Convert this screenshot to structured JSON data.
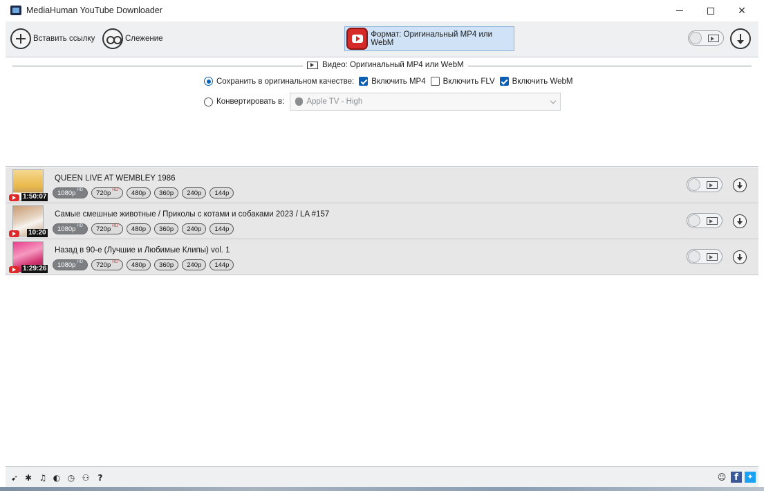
{
  "window": {
    "title": "MediaHuman YouTube Downloader"
  },
  "toolbar": {
    "paste_label": "Вставить ссылку",
    "track_label": "Слежение",
    "format_label": "Формат: Оригинальный MP4 или WebM"
  },
  "settings": {
    "section_title": "Видео: Оригинальный MP4 или WebM",
    "keep_original_label": "Сохранить в оригинальном качестве:",
    "include_mp4_label": "Включить MP4",
    "include_flv_label": "Включить FLV",
    "include_webm_label": "Включить WebM",
    "convert_label": "Конвертировать в:",
    "convert_target": "Apple TV - High",
    "keep_original_selected": true,
    "include_mp4": true,
    "include_flv": false,
    "include_webm": true
  },
  "items": [
    {
      "title": "QUEEN LIVE AT WEMBLEY 1986",
      "duration": "1:50:07",
      "qualities": [
        {
          "label": "1080p",
          "tag": "HD",
          "selected": true
        },
        {
          "label": "720p",
          "tag": "HD",
          "selected": false
        },
        {
          "label": "480p",
          "tag": "",
          "selected": false
        },
        {
          "label": "360p",
          "tag": "",
          "selected": false
        },
        {
          "label": "240p",
          "tag": "",
          "selected": false
        },
        {
          "label": "144p",
          "tag": "",
          "selected": false
        }
      ]
    },
    {
      "title": "Самые смешные животные / Приколы с котами и собаками 2023 / LA #157",
      "duration": "10:20",
      "qualities": [
        {
          "label": "1080p",
          "tag": "HD",
          "selected": true
        },
        {
          "label": "720p",
          "tag": "HD",
          "selected": false
        },
        {
          "label": "480p",
          "tag": "",
          "selected": false
        },
        {
          "label": "360p",
          "tag": "",
          "selected": false
        },
        {
          "label": "240p",
          "tag": "",
          "selected": false
        },
        {
          "label": "144p",
          "tag": "",
          "selected": false
        }
      ]
    },
    {
      "title": "Назад в 90-е (Лучшие и Любимые Клипы)  vol. 1",
      "duration": "1:29:26",
      "qualities": [
        {
          "label": "1080p",
          "tag": "HD",
          "selected": true
        },
        {
          "label": "720p",
          "tag": "HD",
          "selected": false
        },
        {
          "label": "480p",
          "tag": "",
          "selected": false
        },
        {
          "label": "360p",
          "tag": "",
          "selected": false
        },
        {
          "label": "240p",
          "tag": "",
          "selected": false
        },
        {
          "label": "144p",
          "tag": "",
          "selected": false
        }
      ]
    }
  ],
  "statusbar": {
    "icons": [
      "send-icon",
      "gear-icon",
      "music-icon",
      "snail-icon",
      "clock-icon",
      "binoculars-icon",
      "help-icon",
      "support-icon",
      "facebook-icon",
      "twitter-icon"
    ],
    "help_glyph": "?"
  },
  "colors": {
    "accent": "#0a5fb4",
    "format_bg": "#cfe2f6",
    "youtube_red": "#d42a2a",
    "facebook": "#3b5998",
    "twitter": "#1da1f2"
  }
}
